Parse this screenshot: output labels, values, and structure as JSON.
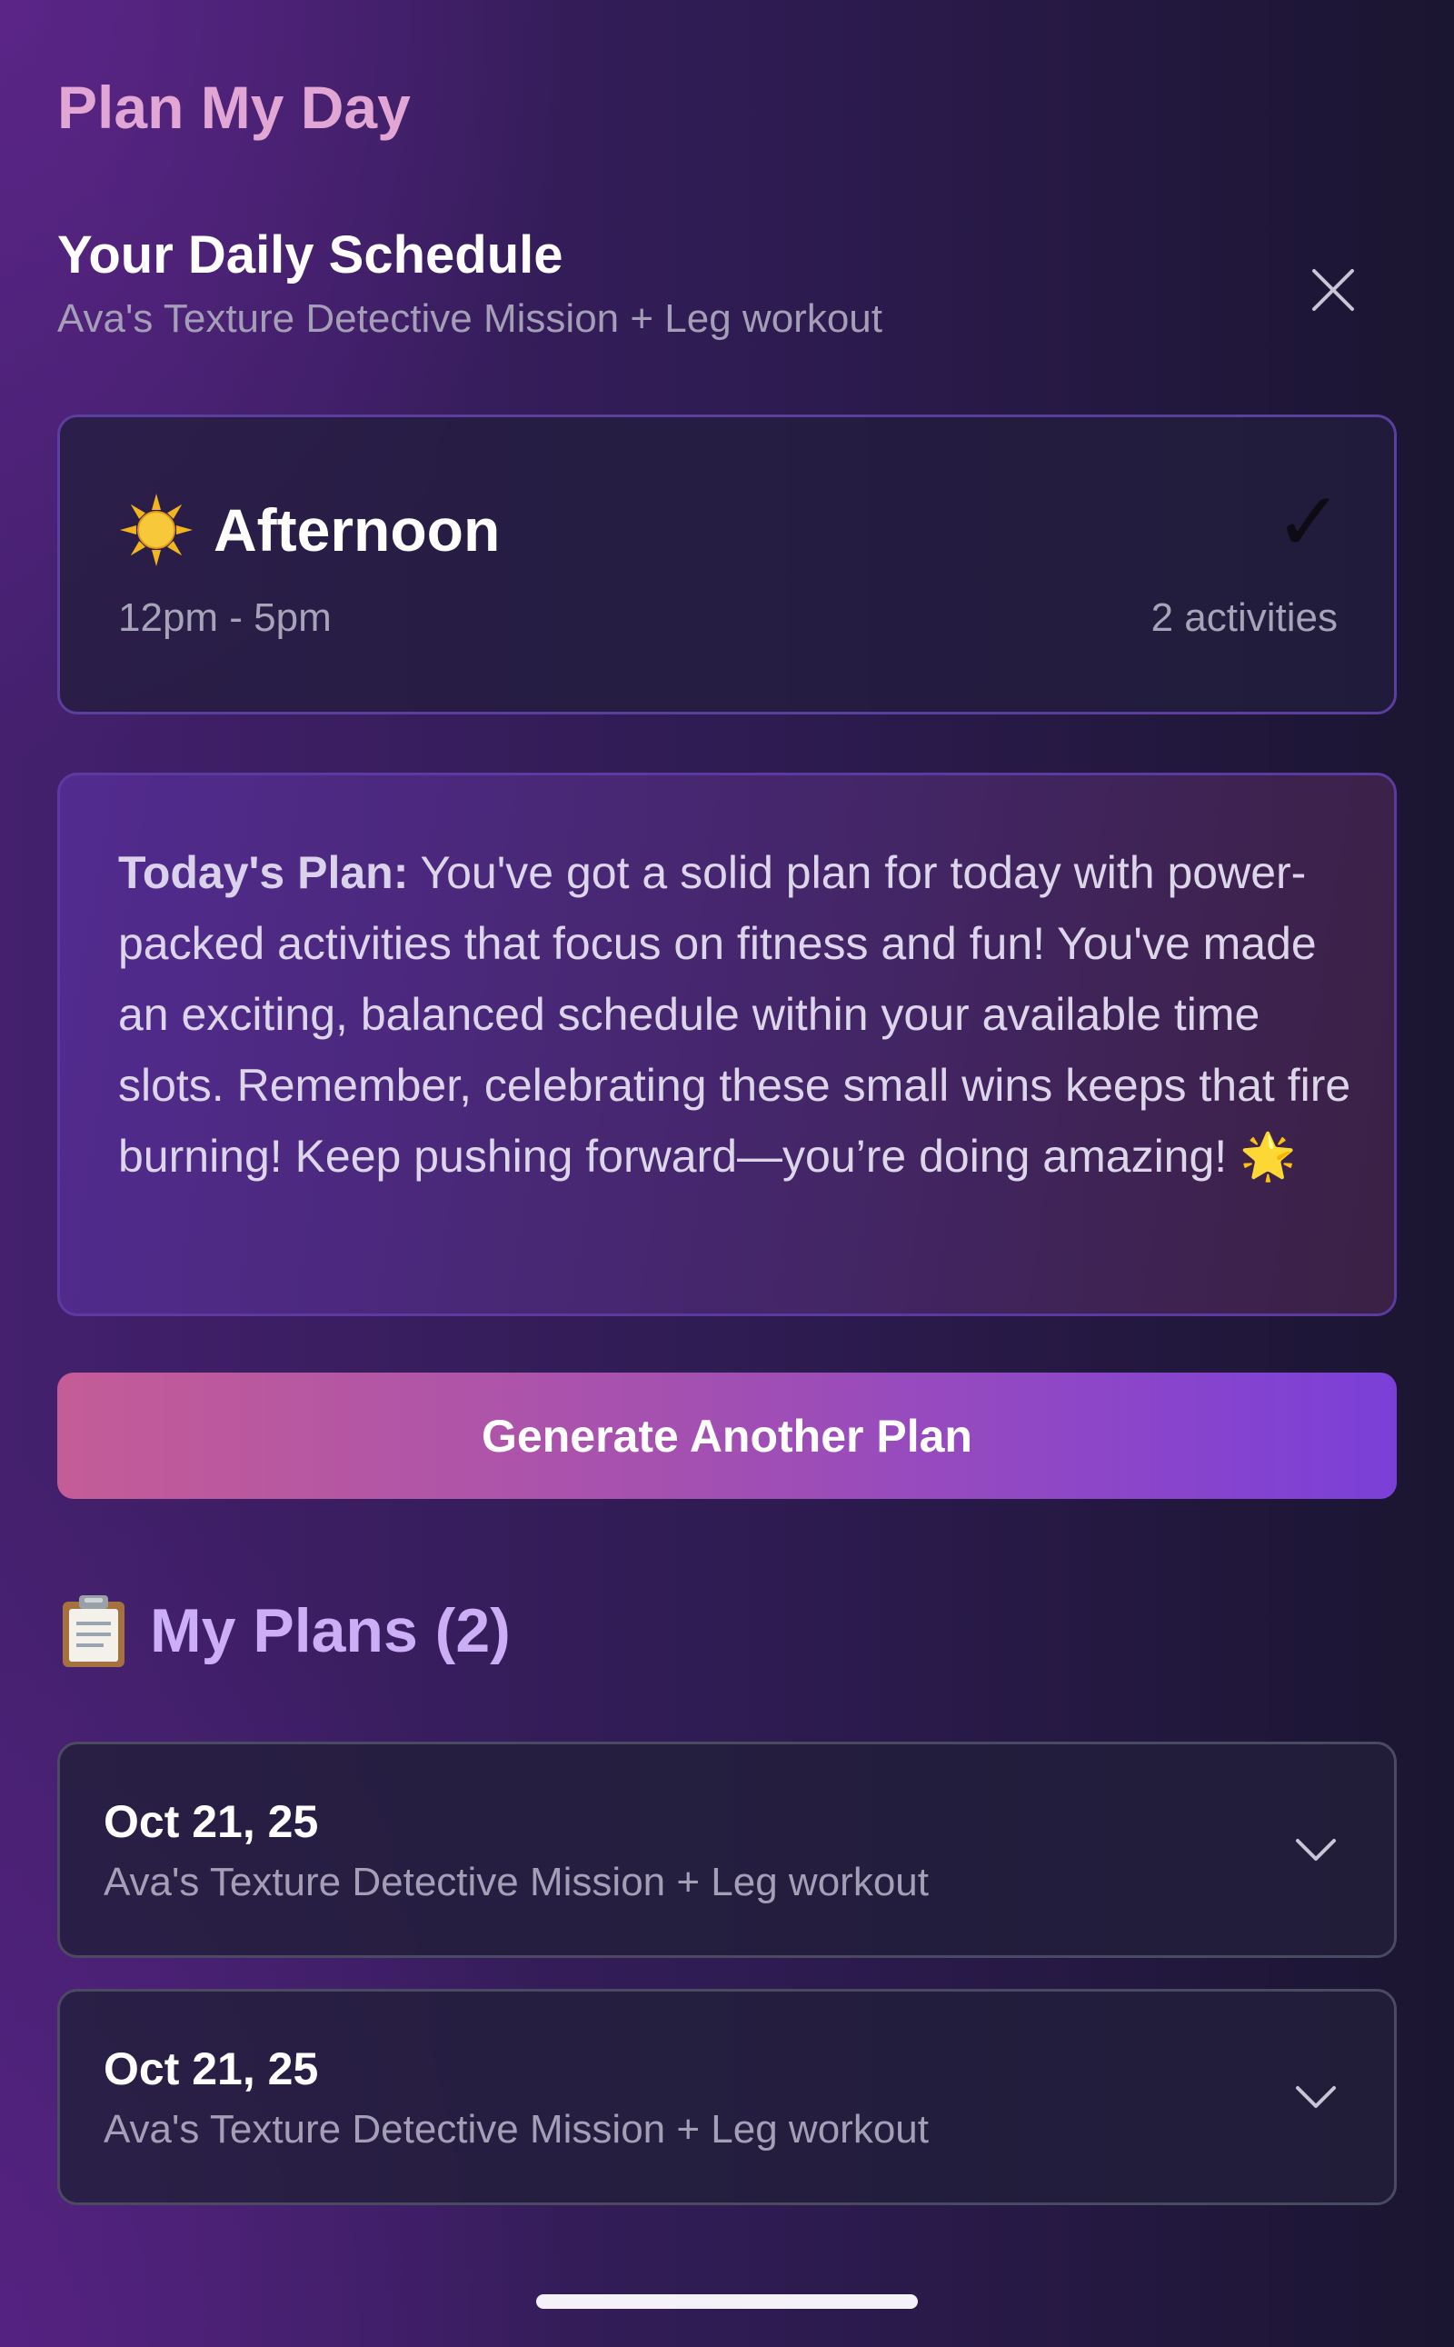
{
  "app": {
    "title": "Plan My Day"
  },
  "schedule": {
    "title": "Your Daily Schedule",
    "subtitle": "Ava's Texture Detective Mission + Leg workout",
    "close_icon": "close-icon"
  },
  "time_slot": {
    "icon": "sun-icon",
    "name": "Afternoon",
    "time_range": "12pm - 5pm",
    "check_glyph": "✓",
    "activity_count": "2 activities"
  },
  "summary": {
    "label": "Today's Plan:",
    "text": " You've got a solid plan for today with power-packed activities that focus on fitness and fun! You've made an exciting, balanced schedule within your available time slots. Remember, celebrating these small wins keeps that fire burning! Keep pushing forward—you’re doing amazing! 🌟"
  },
  "generate_button": {
    "label": "Generate Another Plan"
  },
  "my_plans": {
    "icon": "clipboard-icon",
    "title": "My Plans (2)",
    "items": [
      {
        "date": "Oct 21, 25",
        "description": "Ava's Texture Detective Mission + Leg workout"
      },
      {
        "date": "Oct 21, 25",
        "description": "Ava's Texture Detective Mission + Leg workout"
      }
    ]
  },
  "colors": {
    "title_pink": "#e2a6d4",
    "plans_title_lavender": "#cbaef5",
    "button_gradient_start": "#c45c97",
    "button_gradient_end": "#7b3fd8",
    "card_border_purple": "#5a3f9e"
  }
}
